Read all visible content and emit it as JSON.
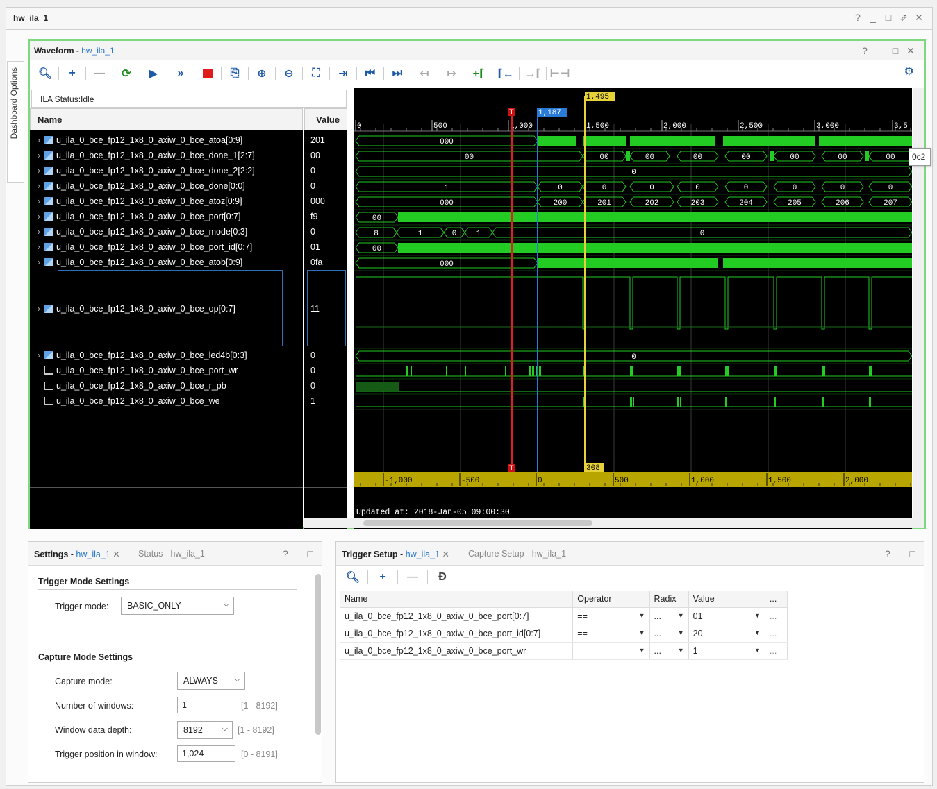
{
  "window": {
    "title": "hw_ila_1",
    "controls": [
      "?",
      "_",
      "□",
      "⇗",
      "✕"
    ]
  },
  "dashboard_tab": "Dashboard Options",
  "waveform": {
    "title": "Waveform",
    "title_link": "hw_ila_1",
    "status": "ILA Status:Idle",
    "name_header": "Name",
    "value_header": "Value",
    "signals": [
      {
        "name": "u_ila_0_bce_fp12_1x8_0_axiw_0_bce_atoa[0:9]",
        "value": "201",
        "kind": "bus"
      },
      {
        "name": "u_ila_0_bce_fp12_1x8_0_axiw_0_bce_done_1[2:7]",
        "value": "00",
        "kind": "bus"
      },
      {
        "name": "u_ila_0_bce_fp12_1x8_0_axiw_0_bce_done_2[2:2]",
        "value": "0",
        "kind": "bus"
      },
      {
        "name": "u_ila_0_bce_fp12_1x8_0_axiw_0_bce_done[0:0]",
        "value": "0",
        "kind": "bus"
      },
      {
        "name": "u_ila_0_bce_fp12_1x8_0_axiw_0_bce_atoz[0:9]",
        "value": "000",
        "kind": "bus"
      },
      {
        "name": "u_ila_0_bce_fp12_1x8_0_axiw_0_bce_port[0:7]",
        "value": "f9",
        "kind": "bus"
      },
      {
        "name": "u_ila_0_bce_fp12_1x8_0_axiw_0_bce_mode[0:3]",
        "value": "0",
        "kind": "bus"
      },
      {
        "name": "u_ila_0_bce_fp12_1x8_0_axiw_0_bce_port_id[0:7]",
        "value": "01",
        "kind": "bus"
      },
      {
        "name": "u_ila_0_bce_fp12_1x8_0_axiw_0_bce_atob[0:9]",
        "value": "0fa",
        "kind": "bus"
      },
      {
        "name": "u_ila_0_bce_fp12_1x8_0_axiw_0_bce_op[0:7]",
        "value": "11",
        "kind": "bus"
      },
      {
        "name": "u_ila_0_bce_fp12_1x8_0_axiw_0_bce_led4b[0:3]",
        "value": "0",
        "kind": "bus"
      },
      {
        "name": "u_ila_0_bce_fp12_1x8_0_axiw_0_bce_port_wr",
        "value": "0",
        "kind": "bit"
      },
      {
        "name": "u_ila_0_bce_fp12_1x8_0_axiw_0_bce_r_pb",
        "value": "0",
        "kind": "bit"
      },
      {
        "name": "u_ila_0_bce_fp12_1x8_0_axiw_0_bce_we",
        "value": "1",
        "kind": "bit"
      }
    ],
    "top_ruler": [
      "0",
      "500",
      "1,000",
      "1,500",
      "2,000",
      "2,500",
      "3,000",
      "3,5"
    ],
    "bottom_ruler": [
      "-1,000",
      "-500",
      "0",
      "500",
      "1,000",
      "1,500",
      "2,000"
    ],
    "cursor_blue": "1,187",
    "cursor_yellow": "1,495",
    "cursor_delta": "308",
    "trigger_marker": "T",
    "updated": "Updated at: 2018-Jan-05 09:00:30",
    "tooltip": "0c2",
    "bus_labels": {
      "atoa": [
        "000"
      ],
      "done_1": [
        "00",
        "00",
        "00",
        "00",
        "00",
        "00",
        "00",
        "00"
      ],
      "done_2": [
        "0"
      ],
      "done": [
        "1",
        "0",
        "0",
        "0",
        "0",
        "0",
        "0",
        "0",
        "0"
      ],
      "atoz": [
        "000",
        "200",
        "201",
        "202",
        "203",
        "204",
        "205",
        "206",
        "207"
      ],
      "port": [
        "00"
      ],
      "mode": [
        "8",
        "1",
        "0",
        "1",
        "0"
      ],
      "port_id": [
        "00"
      ],
      "atob": [
        "000"
      ],
      "led4b": [
        "0"
      ]
    }
  },
  "settings_panel": {
    "tab_active": "Settings",
    "tab_active_link": "hw_ila_1",
    "tab_inactive": "Status - hw_ila_1",
    "trigger_section": "Trigger Mode Settings",
    "trigger_mode_label": "Trigger mode:",
    "trigger_mode_value": "BASIC_ONLY",
    "capture_section": "Capture Mode Settings",
    "capture_mode_label": "Capture mode:",
    "capture_mode_value": "ALWAYS",
    "num_windows_label": "Number of windows:",
    "num_windows_value": "1",
    "num_windows_range": "[1 - 8192]",
    "depth_label": "Window data depth:",
    "depth_value": "8192",
    "depth_range": "[1 - 8192]",
    "trigpos_label": "Trigger position in window:",
    "trigpos_value": "1,024",
    "trigpos_range": "[0 - 8191]"
  },
  "trigger_panel": {
    "tab_active": "Trigger Setup",
    "tab_active_link": "hw_ila_1",
    "tab_inactive": "Capture Setup - hw_ila_1",
    "columns": [
      "Name",
      "Operator",
      "Radix",
      "Value",
      "..."
    ],
    "rows": [
      {
        "name": "u_ila_0_bce_fp12_1x8_0_axiw_0_bce_port[0:7]",
        "operator": "==",
        "radix": "...",
        "value": "01",
        "more": "..."
      },
      {
        "name": "u_ila_0_bce_fp12_1x8_0_axiw_0_bce_port_id[0:7]",
        "operator": "==",
        "radix": "...",
        "value": "20",
        "more": "..."
      },
      {
        "name": "u_ila_0_bce_fp12_1x8_0_axiw_0_bce_port_wr",
        "operator": "==",
        "radix": "...",
        "value": "1",
        "more": "..."
      }
    ]
  }
}
